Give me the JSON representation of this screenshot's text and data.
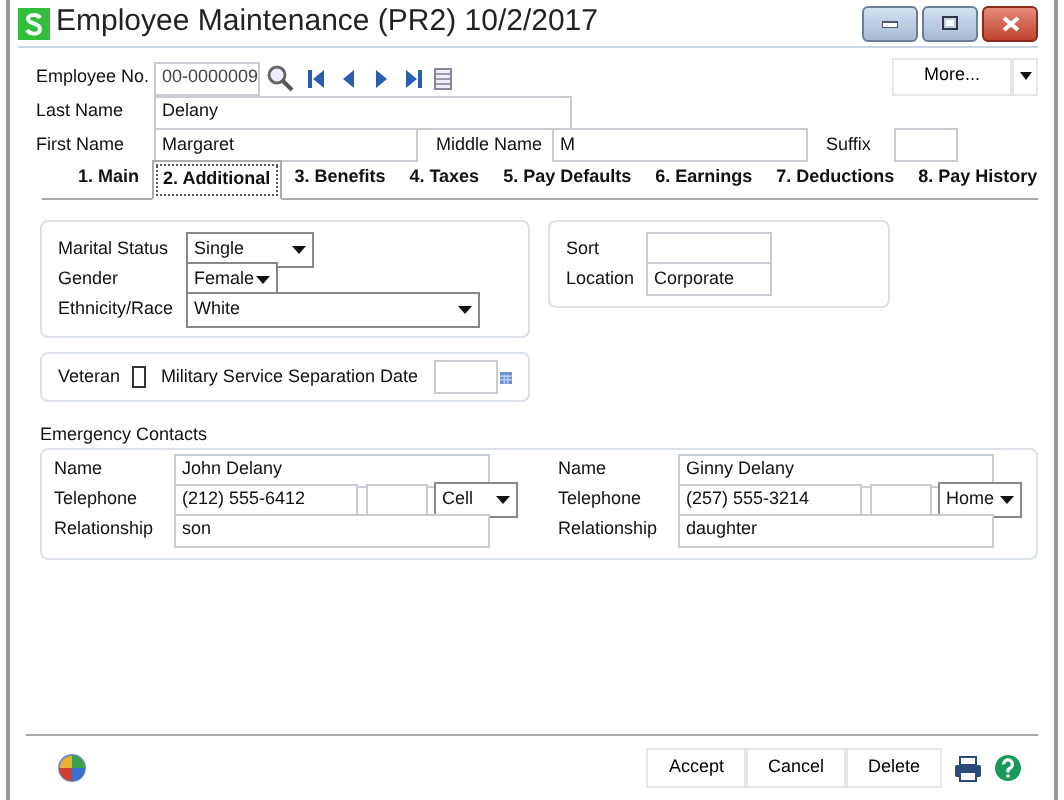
{
  "window": {
    "title": "Employee Maintenance (PR2) 10/2/2017"
  },
  "header": {
    "employee_no": {
      "label": "Employee No.",
      "value": "00-0000009"
    },
    "last_name": {
      "label": "Last Name",
      "value": "Delany"
    },
    "first_name": {
      "label": "First Name",
      "value": "Margaret"
    },
    "middle_name": {
      "label": "Middle Name",
      "value": "M"
    },
    "suffix": {
      "label": "Suffix"
    },
    "more_button": "More..."
  },
  "tabs": [
    {
      "label": "1. Main",
      "selected": false
    },
    {
      "label": "2. Additional",
      "selected": true
    },
    {
      "label": "3. Benefits",
      "selected": false
    },
    {
      "label": "4. Taxes",
      "selected": false
    },
    {
      "label": "5. Pay Defaults",
      "selected": false
    },
    {
      "label": "6. Earnings",
      "selected": false
    },
    {
      "label": "7. Deductions",
      "selected": false
    },
    {
      "label": "8. Pay History",
      "selected": false
    }
  ],
  "personal": [
    {
      "label": "Marital Status",
      "value": "Single",
      "kind": "select"
    },
    {
      "label": "Gender",
      "value": "Female",
      "kind": "select"
    },
    {
      "label": "Ethnicity/Race",
      "value": "White",
      "kind": "select"
    }
  ],
  "sort_location": [
    {
      "label": "Sort"
    },
    {
      "label": "Location",
      "value": "Corporate"
    }
  ],
  "veteran": {
    "label": "Veteran",
    "checked": false,
    "date_label": "Military Service Separation Date"
  },
  "emergency_contacts": {
    "title": "Emergency Contacts",
    "contacts": [
      {
        "name_label": "Name",
        "name": "John Delany",
        "telephone_label": "Telephone",
        "telephone": "(212) 555-6412",
        "phone_type": "Cell",
        "relationship_label": "Relationship",
        "relationship": "son"
      },
      {
        "name_label": "Name",
        "name": "Ginny Delany",
        "telephone_label": "Telephone",
        "telephone": "(257) 555-3214",
        "phone_type": "Home",
        "relationship_label": "Relationship",
        "relationship": "daughter"
      }
    ]
  },
  "footer_buttons": [
    "Accept",
    "Cancel",
    "Delete"
  ]
}
